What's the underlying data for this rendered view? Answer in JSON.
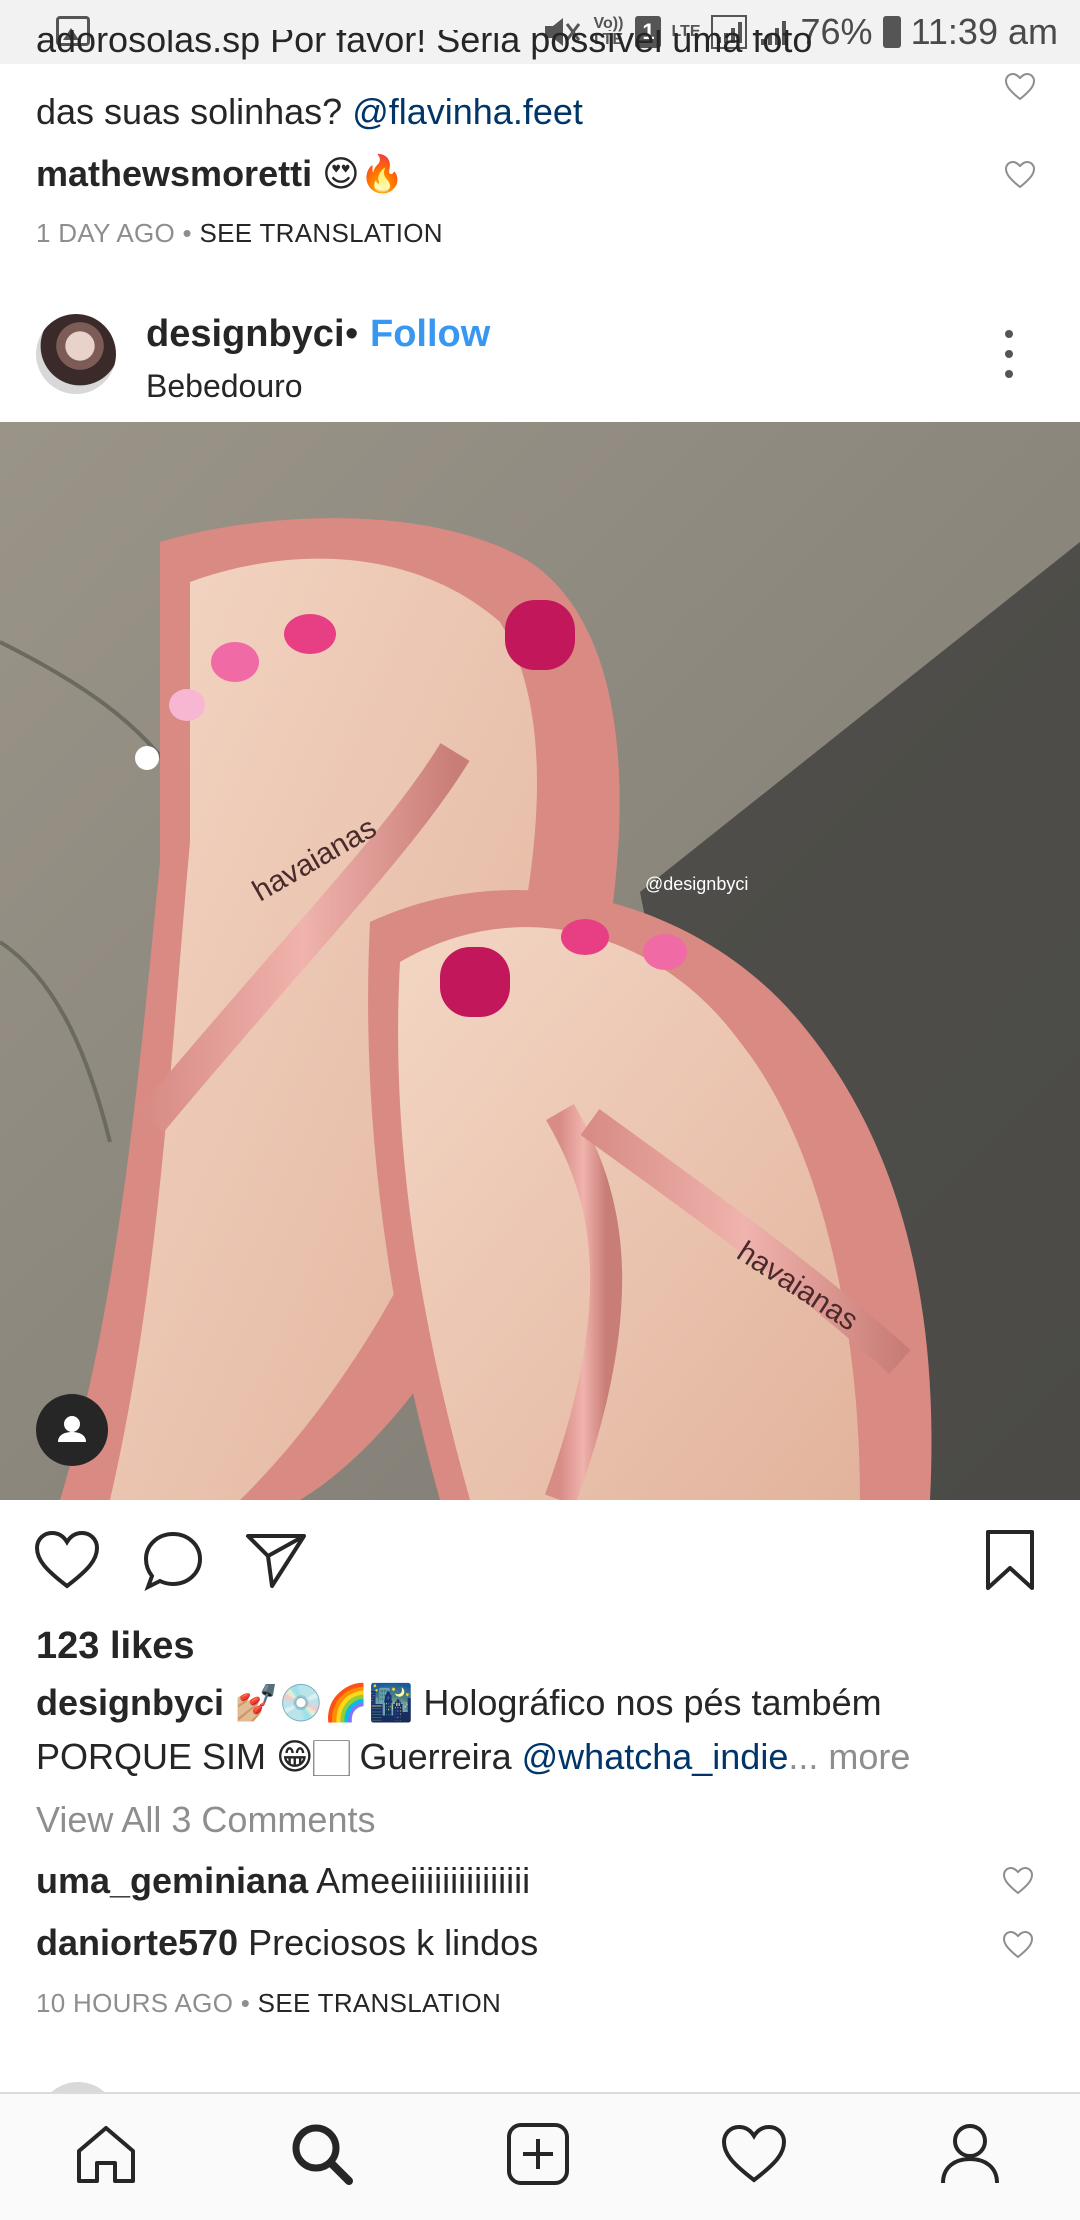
{
  "status_bar": {
    "volte": "Vo)) LTE",
    "sim": "1",
    "lte": "LTE",
    "battery": "76%",
    "time": "11:39 am"
  },
  "prev_comments": {
    "partial_line1": "adorosolas.sp Por favor! Seria possível uma foto",
    "partial_line2_text": "das suas solinhas? ",
    "partial_line2_mention": "@flavinha.feet",
    "comment2_user": "mathewsmoretti",
    "comment2_text": " 😍🔥",
    "time": "1 DAY AGO",
    "separator": " • ",
    "see_translation": "SEE TRANSLATION"
  },
  "post": {
    "username": "designbyci",
    "separator": "•",
    "follow": "Follow",
    "location": "Bebedouro",
    "image_watermark": "@designbyci",
    "sandal_brand": "havaianas",
    "likes": "123 likes",
    "caption_user": "designbyci",
    "caption_line1": " 💅🏼💿🌈🌃 Holográfico nos pés também",
    "caption_line2": "PORQUE SIM 😁🏻 Guerreira ",
    "caption_mention": "@whatcha_indie",
    "caption_more": "... more",
    "view_all": "View All 3 Comments",
    "comments": [
      {
        "user": "uma_geminiana",
        "text": " Ameeiiiiiiiiiiiiiii"
      },
      {
        "user": "daniorte570",
        "text": " Preciosos k lindos"
      }
    ],
    "time": "10 HOURS AGO",
    "separator2": " • ",
    "see_translation": "SEE TRANSLATION"
  },
  "colors": {
    "link_blue": "#3897f0",
    "mention_blue": "#003569",
    "muted": "#8e8e8e",
    "text": "#262626"
  },
  "nav": [
    "home-icon",
    "search-icon",
    "new-post-icon",
    "activity-heart-icon",
    "profile-icon"
  ]
}
